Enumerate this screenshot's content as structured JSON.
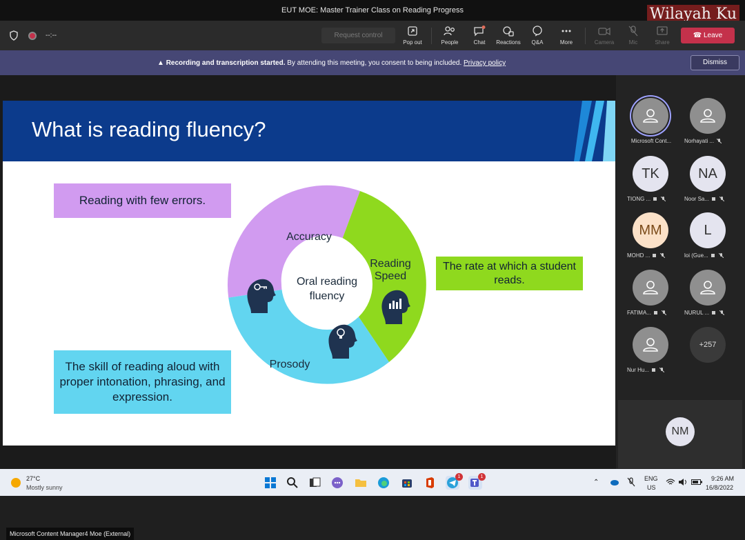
{
  "window": {
    "title": "EUT MOE: Master Trainer Class on Reading Progress",
    "watermark": "Wilayah Ku"
  },
  "meeting_bar": {
    "timer": "--:--",
    "request_control": "Request control",
    "buttons": [
      {
        "label": "Pop out",
        "icon": "pop-out-icon"
      },
      {
        "label": "People",
        "icon": "people-icon"
      },
      {
        "label": "Chat",
        "icon": "chat-icon"
      },
      {
        "label": "Reactions",
        "icon": "reactions-icon"
      },
      {
        "label": "Q&A",
        "icon": "qa-icon"
      },
      {
        "label": "More",
        "icon": "more-icon"
      },
      {
        "label": "Camera",
        "icon": "camera-off-icon"
      },
      {
        "label": "Mic",
        "icon": "mic-off-icon"
      },
      {
        "label": "Share",
        "icon": "share-icon"
      }
    ],
    "leave": "Leave",
    "accent": "#c4314b"
  },
  "banner": {
    "bold": "Recording and transcription started.",
    "text": "By attending this meeting, you consent to being included.",
    "link": "Privacy policy",
    "dismiss": "Dismiss"
  },
  "slide": {
    "title": "What is reading fluency?",
    "errors_box": "Reading with few errors.",
    "rate_box": "The rate at which a student reads.",
    "prosody_box": "The skill of reading aloud with proper intonation, phrasing, and expression.",
    "center_label": "Oral reading fluency",
    "segments": {
      "accuracy": "Accuracy",
      "speed": "Reading Speed",
      "prosody": "Prosody"
    },
    "colors": {
      "header": "#0c3b8c",
      "accuracy": "#d19bf0",
      "speed": "#8fd91e",
      "prosody": "#62d5f0"
    }
  },
  "participants": [
    {
      "name": "Microsoft Cont...",
      "initials": "",
      "selected": true,
      "mic": "none"
    },
    {
      "name": "Norhayati ...",
      "initials": "",
      "mic": "muted"
    },
    {
      "name": "TIONG ...",
      "initials": "TK",
      "mic": "muted"
    },
    {
      "name": "Noor Sa...",
      "initials": "NA",
      "mic": "muted"
    },
    {
      "name": "MOHD ...",
      "initials": "MM",
      "mic": "muted"
    },
    {
      "name": "loi (Gue...",
      "initials": "L",
      "mic": "muted"
    },
    {
      "name": "FATIMA...",
      "initials": "",
      "mic": "muted"
    },
    {
      "name": "NURUL ...",
      "initials": "",
      "mic": "muted"
    },
    {
      "name": "Nur Hu...",
      "initials": "",
      "mic": "muted"
    },
    {
      "name": "",
      "initials": "+257",
      "mic": "none"
    }
  ],
  "self_view": {
    "initials": "NM"
  },
  "presenter_label": "Microsoft Content Manager4 Moe (External)",
  "taskbar": {
    "temperature": "27°C",
    "condition": "Mostly sunny",
    "lang1": "ENG",
    "lang2": "US",
    "time": "9:26 AM",
    "date": "16/8/2022",
    "telegram_badge": "1",
    "teams_badge": "1"
  }
}
